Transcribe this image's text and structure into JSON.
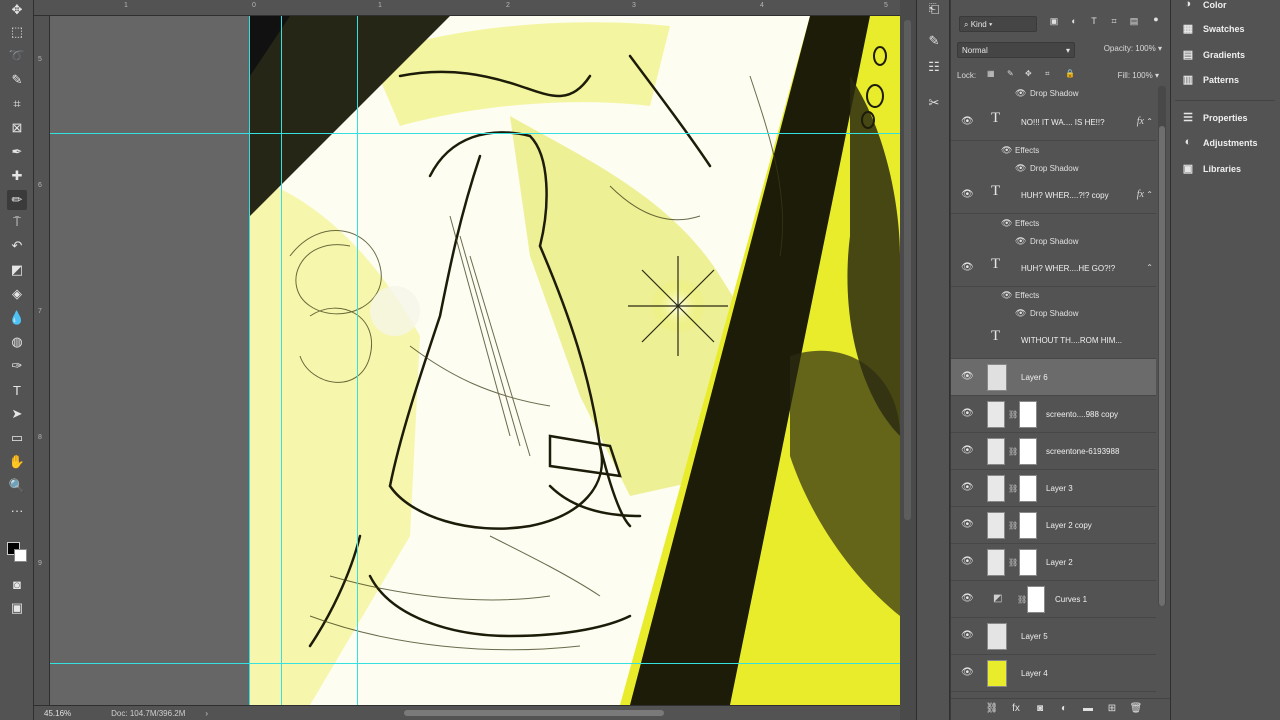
{
  "tools": [
    {
      "name": "move-tool",
      "glyph": "✥"
    },
    {
      "name": "marquee-tool",
      "glyph": "⬚"
    },
    {
      "name": "lasso-tool",
      "glyph": "➰"
    },
    {
      "name": "quick-select-tool",
      "glyph": "✎"
    },
    {
      "name": "crop-tool",
      "glyph": "⌗"
    },
    {
      "name": "frame-tool",
      "glyph": "⊠"
    },
    {
      "name": "eyedropper-tool",
      "glyph": "✒"
    },
    {
      "name": "healing-brush-tool",
      "glyph": "✚"
    },
    {
      "name": "brush-tool",
      "glyph": "✏"
    },
    {
      "name": "clone-stamp-tool",
      "glyph": "⍑"
    },
    {
      "name": "history-brush-tool",
      "glyph": "↶"
    },
    {
      "name": "eraser-tool",
      "glyph": "◩"
    },
    {
      "name": "paint-bucket-tool",
      "glyph": "◈"
    },
    {
      "name": "blur-tool",
      "glyph": "💧"
    },
    {
      "name": "dodge-tool",
      "glyph": "◍"
    },
    {
      "name": "pen-tool",
      "glyph": "✑"
    },
    {
      "name": "type-tool",
      "glyph": "T"
    },
    {
      "name": "path-select-tool",
      "glyph": "➤"
    },
    {
      "name": "rectangle-tool",
      "glyph": "▭"
    },
    {
      "name": "hand-tool",
      "glyph": "✋"
    },
    {
      "name": "zoom-tool",
      "glyph": "🔍"
    },
    {
      "name": "more-tools",
      "glyph": "···"
    }
  ],
  "ruler_top": [
    "1",
    "0",
    "1",
    "2",
    "3",
    "4",
    "5"
  ],
  "ruler_left": [
    "5",
    "6",
    "7",
    "8",
    "9"
  ],
  "status": {
    "zoom": "45.16%",
    "doc": "Doc: 104.7M/396.2M"
  },
  "layers_panel": {
    "filter_kind": "Kind",
    "blend_mode": "Normal",
    "opacity_label": "Opacity:",
    "opacity_value": "100%",
    "lock_label": "Lock:",
    "fill_label": "Fill:",
    "fill_value": "100%",
    "effects_label": "Effects",
    "drop_shadow_label": "Drop Shadow",
    "layers": [
      {
        "name": "NO!!! IT WA.... IS HE!!?",
        "kind": "text",
        "fx": true
      },
      {
        "name": "HUH? WHER....?!? copy",
        "kind": "text",
        "fx": true
      },
      {
        "name": "HUH? WHER....HE GO?!?",
        "kind": "text",
        "fx": true
      },
      {
        "name": "WITHOUT TH....ROM HIM...",
        "kind": "text",
        "fx": false
      },
      {
        "name": "Layer 6",
        "kind": "pixel",
        "selected": true
      },
      {
        "name": "screento....988 copy",
        "kind": "masked"
      },
      {
        "name": "screentone-6193988",
        "kind": "masked"
      },
      {
        "name": "Layer 3",
        "kind": "masked"
      },
      {
        "name": "Layer 2 copy",
        "kind": "masked"
      },
      {
        "name": "Layer 2",
        "kind": "masked"
      },
      {
        "name": "Curves 1",
        "kind": "adjustment"
      },
      {
        "name": "Layer 5",
        "kind": "pixel"
      },
      {
        "name": "Layer 4",
        "kind": "pixel-yellow"
      }
    ]
  },
  "right_panels": [
    "Color",
    "Swatches",
    "Gradients",
    "Patterns",
    "Properties",
    "Adjustments",
    "Libraries"
  ],
  "colors": {
    "guide": "#35e0e0",
    "highlight": "#e8ec2a",
    "ink": "#1c1c08",
    "paper": "#fdfdf2"
  }
}
